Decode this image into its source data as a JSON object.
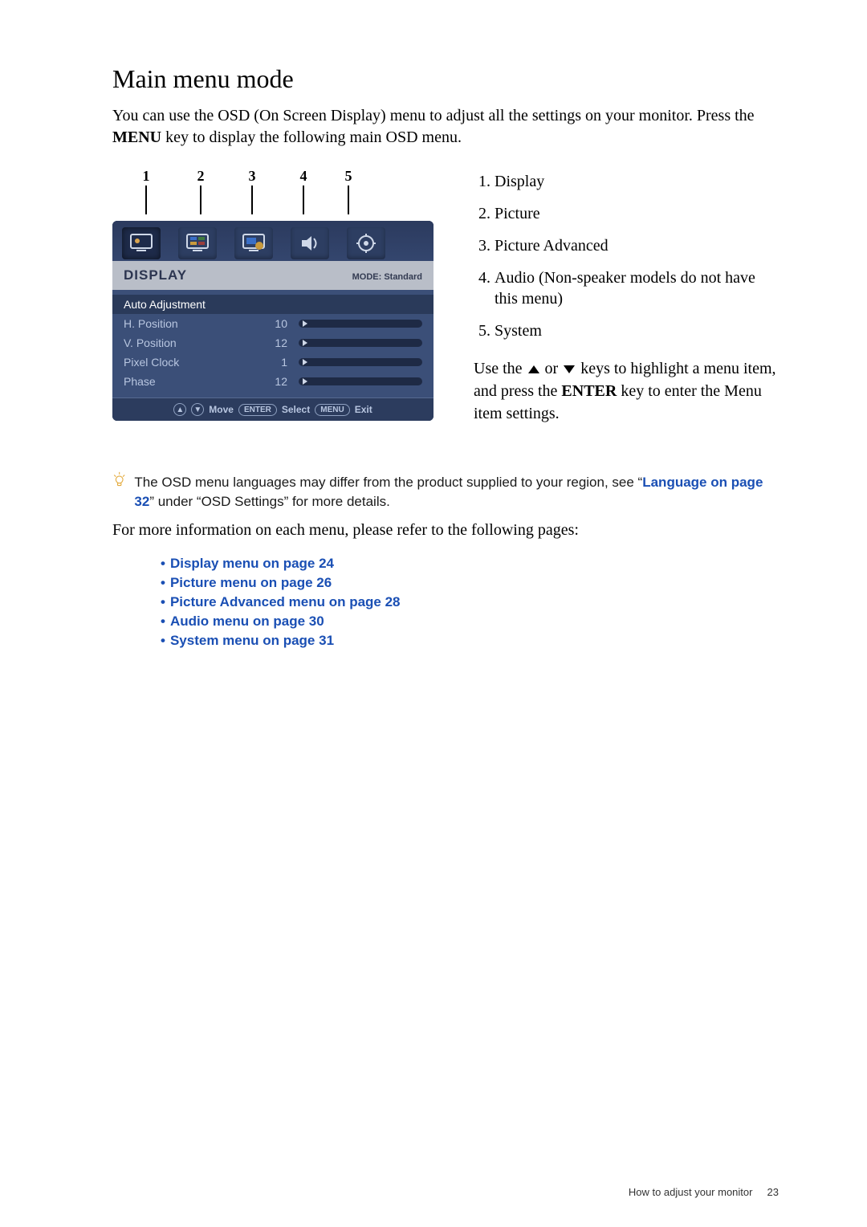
{
  "title": "Main menu mode",
  "intro_1": "You can use the OSD (On Screen Display) menu to adjust all the settings on your monitor. Press the ",
  "intro_menu": "MENU",
  "intro_2": " key to display the following main OSD menu.",
  "callouts": [
    "1",
    "2",
    "3",
    "4",
    "5"
  ],
  "osd": {
    "header_title": "DISPLAY",
    "header_mode": "MODE: Standard",
    "rows": [
      {
        "label": "Auto Adjustment",
        "value": "",
        "has_slider": false
      },
      {
        "label": "H. Position",
        "value": "10",
        "has_slider": true
      },
      {
        "label": "V. Position",
        "value": "12",
        "has_slider": true
      },
      {
        "label": "Pixel Clock",
        "value": "1",
        "has_slider": true
      },
      {
        "label": "Phase",
        "value": "12",
        "has_slider": true
      }
    ],
    "footer": {
      "key_up": "▲",
      "key_down": "▼",
      "move": "Move",
      "enter": "ENTER",
      "select": "Select",
      "menu": "MENU",
      "exit": "Exit"
    }
  },
  "legend": [
    "Display",
    "Picture",
    "Picture Advanced",
    "Audio (Non-speaker models do not have this menu)",
    "System"
  ],
  "use_keys_1": "Use the ",
  "use_keys_or": " or ",
  "use_keys_2": " keys to highlight a menu item, and press the ",
  "use_keys_enter": "ENTER",
  "use_keys_3": " key to enter the Menu item settings.",
  "note_1": "The OSD menu languages may differ from the product supplied to your region, see “",
  "note_link": "Language on page 32",
  "note_2": "” under “OSD Settings” for more details.",
  "after_note": "For more information on each menu, please refer to the following pages:",
  "refs": [
    "Display menu on page 24",
    "Picture menu on page 26",
    "Picture Advanced menu on page 28",
    "Audio menu on page 30",
    "System menu on page 31"
  ],
  "footer_text": "How to adjust your monitor",
  "footer_page": "23"
}
